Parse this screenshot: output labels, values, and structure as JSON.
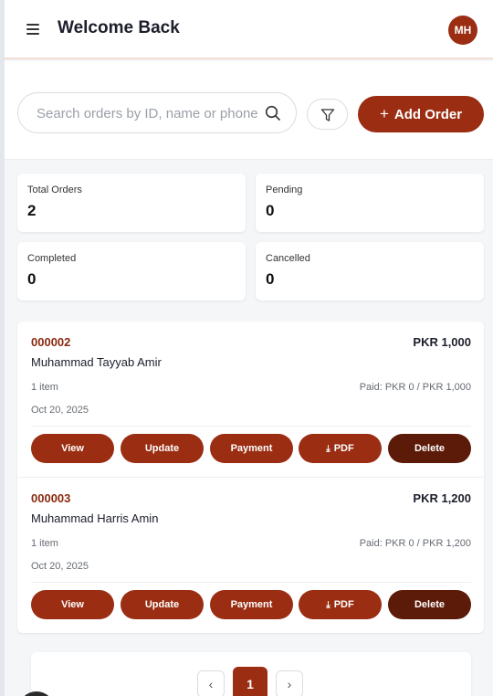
{
  "header": {
    "title": "Welcome Back",
    "avatar_initials": "MH"
  },
  "toolbar": {
    "search_placeholder": "Search orders by ID, name or phone",
    "add_label": "Add Order",
    "add_icon": "plus-icon",
    "filter_icon": "filter-icon",
    "search_icon": "search-icon"
  },
  "stats": [
    {
      "label": "Total Orders",
      "value": "2"
    },
    {
      "label": "Pending",
      "value": "0"
    },
    {
      "label": "Completed",
      "value": "0"
    },
    {
      "label": "Cancelled",
      "value": "0"
    }
  ],
  "orders": [
    {
      "id": "000002",
      "amount": "PKR 1,000",
      "customer": "Muhammad Tayyab Amir",
      "items": "1 item",
      "paid": "Paid: PKR 0 / PKR 1,000",
      "date": "Oct 20, 2025"
    },
    {
      "id": "000003",
      "amount": "PKR 1,200",
      "customer": "Muhammad Harris Amin",
      "items": "1 item",
      "paid": "Paid: PKR 0 / PKR 1,200",
      "date": "Oct 20, 2025"
    }
  ],
  "actions": {
    "view": "View",
    "update": "Update",
    "payment": "Payment",
    "pdf": "PDF",
    "delete": "Delete"
  },
  "pagination": {
    "prev": "‹",
    "current": "1",
    "next": "›"
  },
  "colors": {
    "brand": "#9a2d12",
    "delete": "#5c1a09"
  }
}
